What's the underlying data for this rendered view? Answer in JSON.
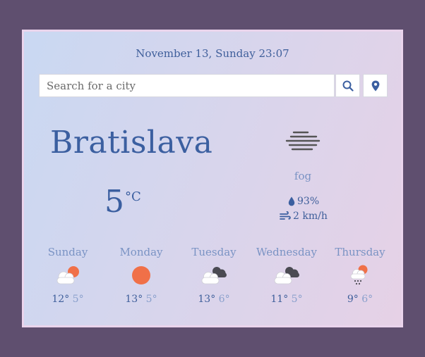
{
  "header": {
    "datetime": "November 13, Sunday 23:07"
  },
  "search": {
    "placeholder": "Search for a city"
  },
  "current": {
    "city": "Bratislava",
    "temperature": "5",
    "unit": "°C",
    "condition": "fog",
    "condition_icon": "fog-icon",
    "humidity": "93%",
    "wind": "2 km/h"
  },
  "forecast": [
    {
      "day": "Sunday",
      "max": "12°",
      "min": "5°",
      "icon": "partly-cloudy-icon"
    },
    {
      "day": "Monday",
      "max": "13°",
      "min": "5°",
      "icon": "sun-icon"
    },
    {
      "day": "Tuesday",
      "max": "13°",
      "min": "6°",
      "icon": "cloudy-icon"
    },
    {
      "day": "Wednesday",
      "max": "11°",
      "min": "5°",
      "icon": "cloudy-icon"
    },
    {
      "day": "Thursday",
      "max": "9°",
      "min": "6°",
      "icon": "rain-icon"
    }
  ],
  "colors": {
    "accent": "#3b5fa0",
    "muted": "#7a93c4",
    "sun": "#f07048",
    "background": "#5f4f6f"
  }
}
